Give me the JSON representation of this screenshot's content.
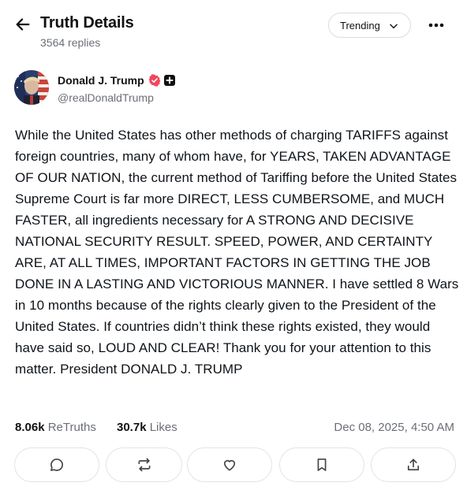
{
  "header": {
    "title": "Truth Details",
    "subtitle": "3564 replies",
    "sort_label": "Trending"
  },
  "author": {
    "name": "Donald J. Trump",
    "handle": "@realDonaldTrump"
  },
  "post": {
    "text": "While the United States has other methods of charging TARIFFS against foreign countries, many of whom have, for YEARS, TAKEN ADVANTAGE OF OUR NATION, the current method of Tariffing before the United States Supreme Court is far more DIRECT, LESS CUMBERSOME, and MUCH FASTER, all ingredients necessary for A STRONG AND DECISIVE NATIONAL SECURITY RESULT. SPEED, POWER, AND CERTAINTY ARE, AT ALL TIMES, IMPORTANT FACTORS IN GETTING THE JOB DONE IN A LASTING AND VICTORIOUS MANNER. I have settled 8 Wars in 10 months because of the rights clearly given to the President of the United States. If countries didn’t think these rights existed, they would have said so, LOUD AND CLEAR! Thank you for your attention to this matter. President DONALD J. TRUMP",
    "retruths_count": "8.06k",
    "retruths_label": "ReTruths",
    "likes_count": "30.7k",
    "likes_label": "Likes",
    "timestamp": "Dec 08, 2025, 4:50 AM"
  },
  "icons": {
    "back": "arrow-left-icon",
    "sort": "chevron-down-icon",
    "more": "more-horizontal-icon",
    "verified": "verified-badge-icon",
    "plus": "plus-badge-icon",
    "reply": "reply-icon",
    "retruth": "retruth-icon",
    "like": "heart-icon",
    "bookmark": "bookmark-icon",
    "share": "share-icon"
  },
  "colors": {
    "verified": "#f0475e",
    "text": "#0f1419",
    "muted": "#6b6f76",
    "border": "#e1e3e8"
  }
}
